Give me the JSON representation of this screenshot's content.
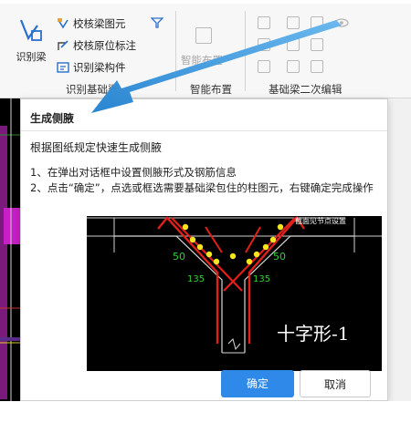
{
  "ribbon": {
    "identify_beam": "识别梁",
    "check_beam_element": "校核梁图元",
    "check_origin_annotation": "校核原位标注",
    "identify_beam_member": "识别梁构件",
    "smart_layout": "智能布置",
    "group_identify_foundation": "识别基础梁",
    "group_smart_layout": "智能布置",
    "group_secondary_edit": "基础梁二次编辑"
  },
  "tooltip": {
    "title": "生成侧腋",
    "description": "根据图纸规定快速生成侧腋",
    "step1": "1、在弹出对话框中设置侧腋形式及钢筋信息",
    "step2": "2、点击“确定”，点选或框选需要基础梁包住的柱图元，右键确定完成操作",
    "image_label_tr": "截面见节点设置",
    "image_num_left": "50",
    "image_num_right": "50",
    "image_angle_left": "135",
    "image_angle_right": "135",
    "image_caption": "十字形-1",
    "ok_button": "确定",
    "cancel_button": "取消"
  },
  "colors": {
    "arrow": "#3a9ad9",
    "ok_button": "#2f89e8",
    "rebar_red": "#e0201b",
    "rebar_yellow": "#f4e81d",
    "dim_green": "#2fd12f"
  }
}
